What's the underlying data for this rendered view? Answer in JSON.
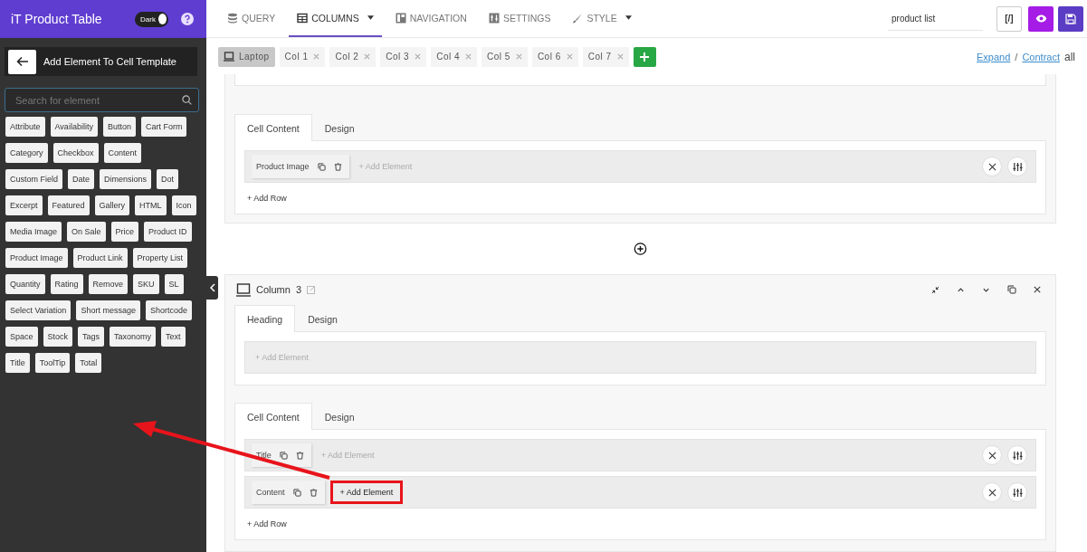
{
  "app": {
    "title": "iT Product Table",
    "theme_toggle": {
      "label": "Dark",
      "on": true
    }
  },
  "panel": {
    "title": "Add Element To Cell Template",
    "search": {
      "placeholder": "Search for element"
    },
    "elements": [
      "Attribute",
      "Availability",
      "Button",
      "Cart Form",
      "Category",
      "Checkbox",
      "Content",
      "Custom Field",
      "Date",
      "Dimensions",
      "Dot",
      "Excerpt",
      "Featured",
      "Gallery",
      "HTML",
      "Icon",
      "Media Image",
      "On Sale",
      "Price",
      "Product ID",
      "Product Image",
      "Product Link",
      "Property List",
      "Quantity",
      "Rating",
      "Remove",
      "SKU",
      "SL",
      "Select Variation",
      "Short message",
      "Shortcode",
      "Space",
      "Stock",
      "Tags",
      "Taxonomy",
      "Text",
      "Title",
      "ToolTip",
      "Total"
    ]
  },
  "nav": {
    "tabs": [
      {
        "label": "QUERY",
        "kind": "query",
        "selected": false,
        "dropdown": false
      },
      {
        "label": "COLUMNS",
        "kind": "columns",
        "selected": true,
        "dropdown": true
      },
      {
        "label": "NAVIGATION",
        "kind": "navigation",
        "selected": false,
        "dropdown": false
      },
      {
        "label": "SETTINGS",
        "kind": "settings",
        "selected": false,
        "dropdown": false
      },
      {
        "label": "STYLE",
        "kind": "style",
        "selected": false,
        "dropdown": true
      }
    ],
    "name_field": {
      "value": "product list"
    },
    "shortcode_button": "[/]"
  },
  "device": {
    "label": "Laptop",
    "selected": true
  },
  "column_chips": [
    "Col 1",
    "Col 2",
    "Col 3",
    "Col 4",
    "Col 5",
    "Col 6",
    "Col 7"
  ],
  "expand_links": {
    "expand": "Expand",
    "separator": "/",
    "contract": "Contract",
    "suffix": "all"
  },
  "previous_column": {
    "tabs": [
      {
        "label": "Cell Content",
        "selected": true
      },
      {
        "label": "Design",
        "selected": false
      }
    ],
    "rows": [
      {
        "elements": [
          "Product Image"
        ],
        "add_element": "+ Add Element",
        "highlighted": false
      }
    ],
    "add_row": "+ Add Row"
  },
  "column": {
    "title": "Column",
    "number": "3",
    "heading": {
      "tabs": [
        {
          "label": "Heading",
          "selected": true
        },
        {
          "label": "Design",
          "selected": false
        }
      ],
      "add_element": "+ Add Element"
    },
    "cell": {
      "tabs": [
        {
          "label": "Cell Content",
          "selected": true
        },
        {
          "label": "Design",
          "selected": false
        }
      ],
      "rows": [
        {
          "elements": [
            "Title"
          ],
          "add_element": "+ Add Element",
          "highlighted": false
        },
        {
          "elements": [
            "Content"
          ],
          "add_element": "+ Add Element",
          "highlighted": true
        }
      ],
      "add_row": "+ Add Row"
    }
  }
}
